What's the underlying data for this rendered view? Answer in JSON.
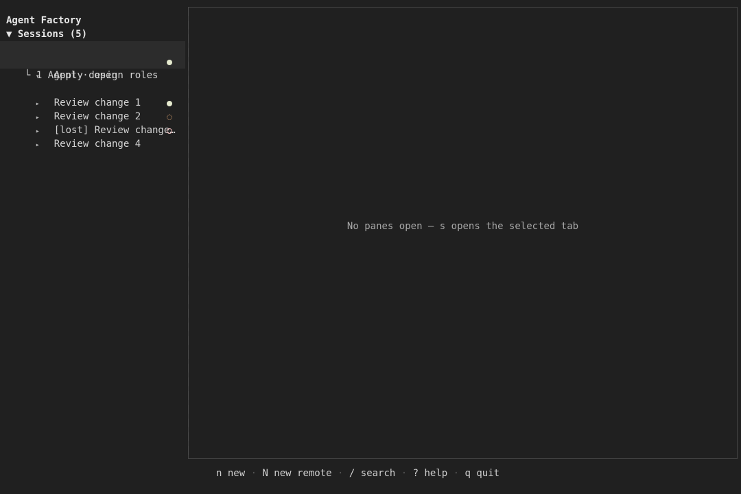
{
  "app_title": "Agent Factory",
  "sessions_header": "▼ Sessions (5)",
  "sessions": [
    {
      "caret": "▾",
      "label": "Apply design roles",
      "status": "active",
      "selected": true,
      "expanded": true
    },
    {
      "caret": "▸",
      "label": "Review change 1",
      "status": "none"
    },
    {
      "caret": "▸",
      "label": "Review change 2",
      "status": "active"
    },
    {
      "caret": "▸",
      "label": "[lost] Review change…",
      "status": "lost"
    },
    {
      "caret": "▸",
      "label": "Review change 4",
      "status": "idle"
    }
  ],
  "session_child": "└ 1 Agent · open",
  "status_icons": {
    "active": "filled-circle-icon",
    "lost": "dotted-circle-icon",
    "idle": "hollow-circle-icon"
  },
  "colors": {
    "background": "#202020",
    "selected_row": "#2c2c2c",
    "active_dot": "#e6ebcf",
    "idle_dot": "#e8b8b8",
    "lost_dot": "#d8a070"
  },
  "empty_message": "No panes open — s opens the selected tab",
  "footer": {
    "new_key": "n new",
    "new_remote_key": "N new remote",
    "search_key": "/ search",
    "help_key": "? help",
    "quit_key": "q quit",
    "separator": " · "
  }
}
